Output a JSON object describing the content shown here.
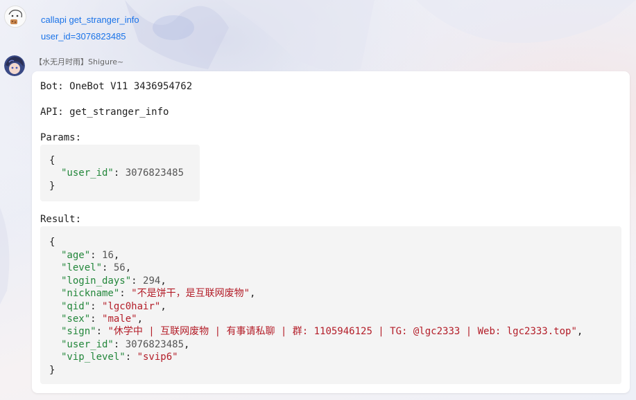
{
  "messages": [
    {
      "type": "user_command",
      "lines": [
        "callapi get_stranger_info",
        "user_id=3076823485"
      ]
    }
  ],
  "reply": {
    "sender": "【水无月时雨】Shigure~",
    "bot_line": "Bot: OneBot V11 3436954762",
    "api_line": "API: get_stranger_info",
    "params_label": "Params:",
    "params": [
      {
        "key": "\"user_id\"",
        "value": "3076823485",
        "kind": "n"
      }
    ],
    "result_label": "Result:",
    "result": [
      {
        "key": "\"age\"",
        "value": "16",
        "kind": "n"
      },
      {
        "key": "\"level\"",
        "value": "56",
        "kind": "n"
      },
      {
        "key": "\"login_days\"",
        "value": "294",
        "kind": "n"
      },
      {
        "key": "\"nickname\"",
        "value": "\"不是饼干，是互联网废物\"",
        "kind": "s"
      },
      {
        "key": "\"qid\"",
        "value": "\"lgc0hair\"",
        "kind": "s"
      },
      {
        "key": "\"sex\"",
        "value": "\"male\"",
        "kind": "s"
      },
      {
        "key": "\"sign\"",
        "value": "\"休学中 | 互联网废物 | 有事请私聊 | 群: 1105946125 | TG: @lgc2333 | Web: lgc2333.top\"",
        "kind": "s"
      },
      {
        "key": "\"user_id\"",
        "value": "3076823485",
        "kind": "n"
      },
      {
        "key": "\"vip_level\"",
        "value": "\"svip6\"",
        "kind": "s"
      }
    ],
    "open_brace": "{",
    "close_brace": "}",
    "colon": ": ",
    "comma": ","
  },
  "icons": {
    "user_avatar": "avatar-icon",
    "bot_avatar": "avatar-icon"
  }
}
